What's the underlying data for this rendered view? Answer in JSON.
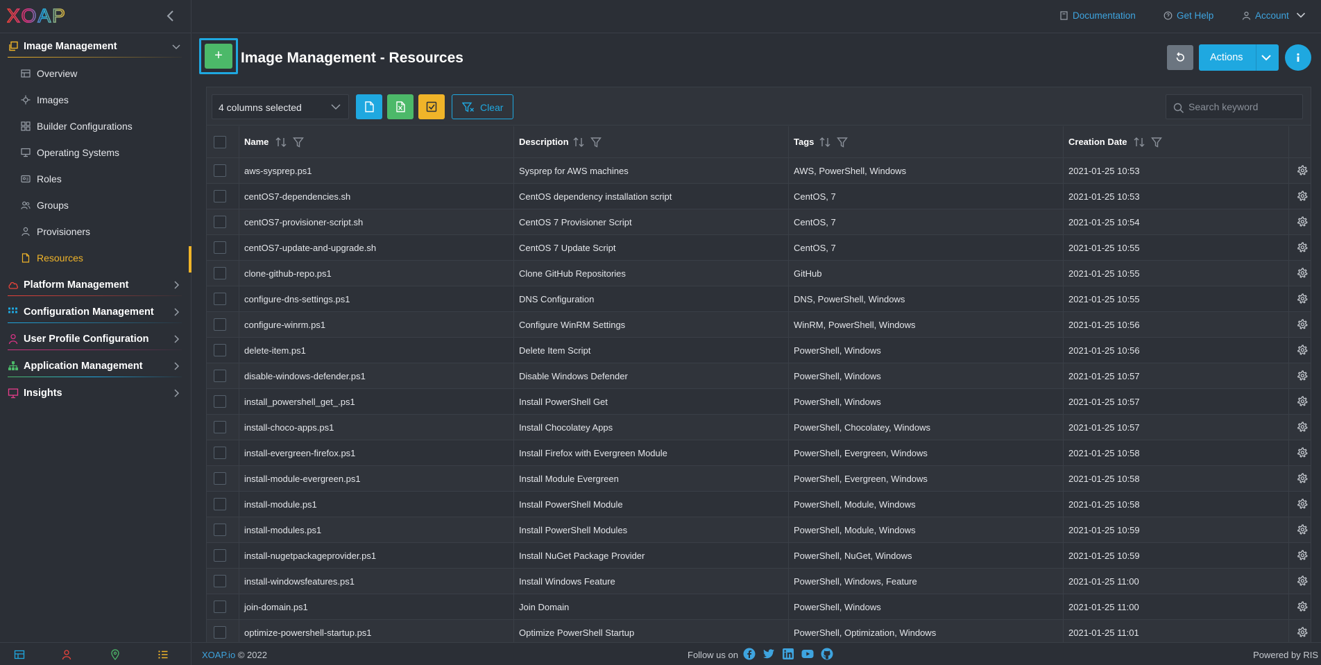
{
  "app": {
    "logo_text": "XOAP"
  },
  "colors": {
    "accent": "#1fa8e0",
    "active": "#f0b429",
    "add_button": "#4cb969",
    "background": "#2b2f36",
    "csv_button": "#1fa8e0",
    "excel_button": "#4cb969",
    "check_button": "#f0b429"
  },
  "topbar": {
    "documentation": "Documentation",
    "get_help": "Get Help",
    "account": "Account"
  },
  "sidebar": {
    "sections": [
      {
        "label": "Image Management",
        "icon": "copy-icon",
        "color": "#f0b429",
        "expanded": true
      },
      {
        "label": "Platform Management",
        "icon": "cloud-icon",
        "color": "#e8433a"
      },
      {
        "label": "Configuration Management",
        "icon": "grid-icon",
        "color": "#1fa8e0"
      },
      {
        "label": "User Profile Configuration",
        "icon": "user-icon",
        "color": "#d63384"
      },
      {
        "label": "Application Management",
        "icon": "sitemap-icon",
        "color": "#4cb969"
      },
      {
        "label": "Insights",
        "icon": "monitor-icon",
        "color": "#e83e8c"
      }
    ],
    "items": [
      {
        "label": "Overview",
        "icon": "table-icon"
      },
      {
        "label": "Images",
        "icon": "plug-icon"
      },
      {
        "label": "Builder Configurations",
        "icon": "blocks-icon"
      },
      {
        "label": "Operating Systems",
        "icon": "desktop-icon"
      },
      {
        "label": "Roles",
        "icon": "id-card-icon"
      },
      {
        "label": "Groups",
        "icon": "users-icon"
      },
      {
        "label": "Provisioners",
        "icon": "person-icon"
      },
      {
        "label": "Resources",
        "icon": "file-icon",
        "active": true
      }
    ],
    "bottom_icons": [
      "dashboard-icon",
      "user-config-icon",
      "location-icon",
      "list-icon"
    ]
  },
  "page": {
    "title": "Image Management - Resources",
    "add_label": "+",
    "actions_label": "Actions"
  },
  "table": {
    "columns_selected": "4 columns selected",
    "clear_label": "Clear",
    "search_placeholder": "Search keyword",
    "headers": [
      "Name",
      "Description",
      "Tags",
      "Creation Date"
    ],
    "rows": [
      [
        "aws-sysprep.ps1",
        "Sysprep for AWS machines",
        "AWS, PowerShell, Windows",
        "2021-01-25 10:53"
      ],
      [
        "centOS7-dependencies.sh",
        "CentOS dependency installation script",
        "CentOS, 7",
        "2021-01-25 10:53"
      ],
      [
        "centOS7-provisioner-script.sh",
        "CentOS 7 Provisioner Script",
        "CentOS, 7",
        "2021-01-25 10:54"
      ],
      [
        "centOS7-update-and-upgrade.sh",
        "CentOS 7 Update Script",
        "CentOS, 7",
        "2021-01-25 10:55"
      ],
      [
        "clone-github-repo.ps1",
        "Clone GitHub Repositories",
        "GitHub",
        "2021-01-25 10:55"
      ],
      [
        "configure-dns-settings.ps1",
        "DNS Configuration",
        "DNS, PowerShell, Windows",
        "2021-01-25 10:55"
      ],
      [
        "configure-winrm.ps1",
        "Configure WinRM Settings",
        "WinRM, PowerShell, Windows",
        "2021-01-25 10:56"
      ],
      [
        "delete-item.ps1",
        "Delete Item Script",
        "PowerShell, Windows",
        "2021-01-25 10:56"
      ],
      [
        "disable-windows-defender.ps1",
        "Disable Windows Defender",
        "PowerShell, Windows",
        "2021-01-25 10:57"
      ],
      [
        "install_powershell_get_.ps1",
        "Install PowerShell Get",
        "PowerShell, Windows",
        "2021-01-25 10:57"
      ],
      [
        "install-choco-apps.ps1",
        "Install Chocolatey Apps",
        "PowerShell, Chocolatey, Windows",
        "2021-01-25 10:57"
      ],
      [
        "install-evergreen-firefox.ps1",
        "Install Firefox with Evergreen Module",
        "PowerShell, Evergreen, Windows",
        "2021-01-25 10:58"
      ],
      [
        "install-module-evergreen.ps1",
        "Install Module Evergreen",
        "PowerShell, Evergreen, Windows",
        "2021-01-25 10:58"
      ],
      [
        "install-module.ps1",
        "Install PowerShell Module",
        "PowerShell, Module, Windows",
        "2021-01-25 10:58"
      ],
      [
        "install-modules.ps1",
        "Install PowerShell Modules",
        "PowerShell, Module, Windows",
        "2021-01-25 10:59"
      ],
      [
        "install-nugetpackageprovider.ps1",
        "Install NuGet Package Provider",
        "PowerShell, NuGet, Windows",
        "2021-01-25 10:59"
      ],
      [
        "install-windowsfeatures.ps1",
        "Install Windows Feature",
        "PowerShell, Windows, Feature",
        "2021-01-25 11:00"
      ],
      [
        "join-domain.ps1",
        "Join Domain",
        "PowerShell, Windows",
        "2021-01-25 11:00"
      ],
      [
        "optimize-powershell-startup.ps1",
        "Optimize PowerShell Startup",
        "PowerShell, Optimization, Windows",
        "2021-01-25 11:01"
      ]
    ]
  },
  "footer": {
    "brand_link": "XOAP.io",
    "copyright": "© 2022",
    "follow": "Follow us on",
    "social": [
      "facebook-icon",
      "twitter-icon",
      "linkedin-icon",
      "youtube-icon",
      "github-icon"
    ],
    "powered": "Powered by RIS"
  }
}
